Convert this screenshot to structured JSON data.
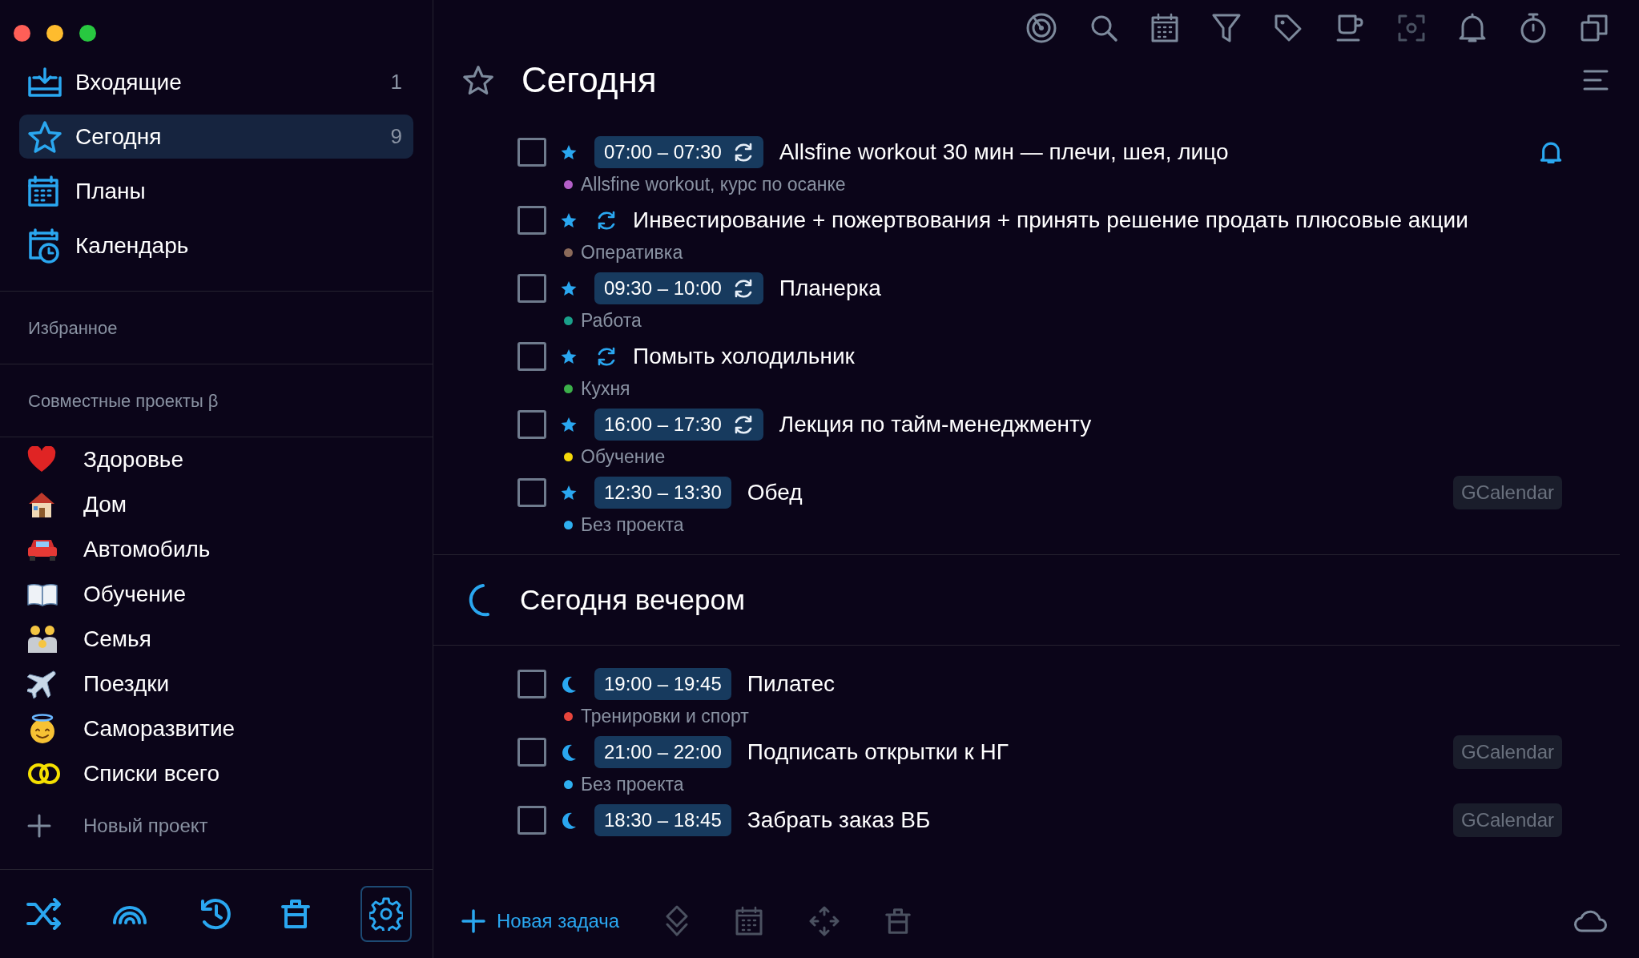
{
  "sidebar": {
    "nav": [
      {
        "label": "Входящие",
        "count": "1",
        "selected": false
      },
      {
        "label": "Сегодня",
        "count": "9",
        "selected": true
      },
      {
        "label": "Планы",
        "selected": false
      },
      {
        "label": "Календарь",
        "selected": false
      }
    ],
    "favorites_heading": "Избранное",
    "shared_heading": "Совместные проекты β",
    "projects": [
      {
        "label": "Здоровье"
      },
      {
        "label": "Дом"
      },
      {
        "label": "Автомобиль"
      },
      {
        "label": "Обучение"
      },
      {
        "label": "Семья"
      },
      {
        "label": "Поездки"
      },
      {
        "label": "Саморазвитие"
      },
      {
        "label": "Списки всего"
      }
    ],
    "new_project": "Новый проект"
  },
  "main": {
    "title": "Сегодня",
    "tasks": [
      {
        "checked": false,
        "time": "07:00 – 07:30",
        "recurring": true,
        "title": "Allsfine workout 30 мин — плечи, шея, лицо",
        "project": "Allsfine workout, курс по осанке",
        "color": "#b45fc8",
        "alarm": true
      },
      {
        "checked": false,
        "recurring": true,
        "title": "Инвестирование + пожертвования + принять решение продать плюсовые акции",
        "project": "Оперативка",
        "color": "#8b6a5a",
        "alarm": false
      },
      {
        "checked": false,
        "time": "09:30 – 10:00",
        "recurring": true,
        "title": "Планерка",
        "project": "Работа",
        "color": "#1aa08a",
        "alarm": false
      },
      {
        "checked": false,
        "recurring": true,
        "title": "Помыть холодильник",
        "project": "Кухня",
        "color": "#3cb04a",
        "alarm": false
      },
      {
        "checked": false,
        "time": "16:00 – 17:30",
        "recurring": true,
        "title": "Лекция по тайм-менеджменту",
        "project": "Обучение",
        "color": "#f5d90a",
        "alarm": false
      },
      {
        "checked": false,
        "time": "12:30 – 13:30",
        "recurring": false,
        "title": "Обед",
        "project": "Без проекта",
        "color": "#2fb0f0",
        "alarm": false,
        "source": "GCalendar"
      }
    ],
    "evening_title": "Сегодня вечером",
    "evening_tasks": [
      {
        "checked": false,
        "time": "19:00 – 19:45",
        "recurring": false,
        "title": "Пилатес",
        "project": "Тренировки и спорт",
        "color": "#e8453c",
        "alarm": false
      },
      {
        "checked": false,
        "time": "21:00 – 22:00",
        "recurring": false,
        "title": "Подписать открытки к НГ",
        "project": "Без проекта",
        "color": "#2fb0f0",
        "alarm": false,
        "source": "GCalendar"
      },
      {
        "checked": false,
        "time": "18:30 – 18:45",
        "recurring": false,
        "title": "Забрать заказ ВБ",
        "alarm": false,
        "source": "GCalendar"
      }
    ],
    "new_task": "Новая задача"
  }
}
